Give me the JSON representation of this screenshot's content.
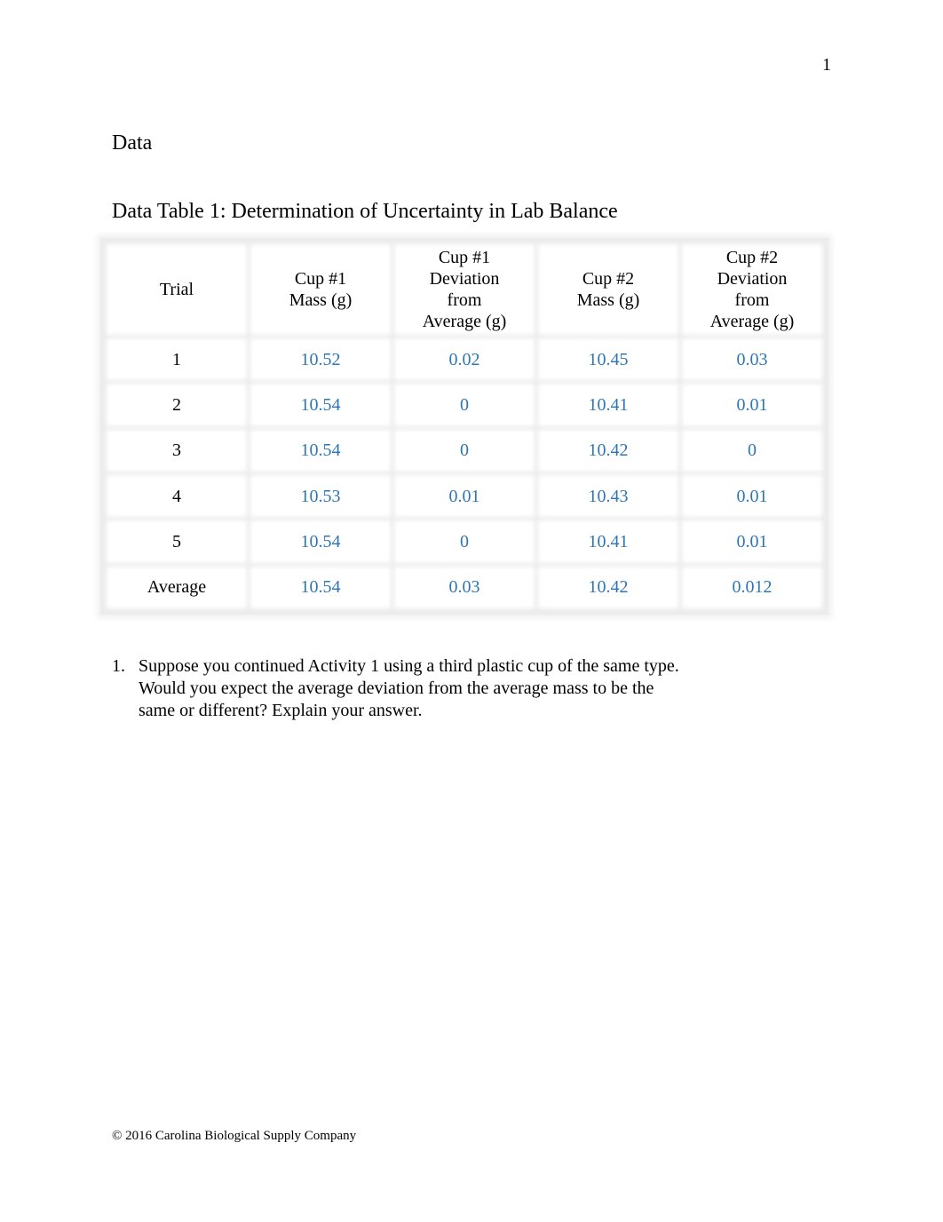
{
  "page_number": "1",
  "section_heading": "Data",
  "table": {
    "title": "Data Table 1: Determination of Uncertainty in Lab Balance",
    "headers": [
      [
        "Trial"
      ],
      [
        "Cup #1",
        "Mass (g)"
      ],
      [
        "Cup #1",
        "Deviation",
        "from",
        "Average (g)"
      ],
      [
        "Cup #2",
        "Mass (g)"
      ],
      [
        "Cup #2",
        "Deviation",
        "from",
        "Average (g)"
      ]
    ],
    "rows": [
      {
        "label": "1",
        "cup1_mass": "10.52",
        "cup1_dev": "0.02",
        "cup2_mass": "10.45",
        "cup2_dev": "0.03"
      },
      {
        "label": "2",
        "cup1_mass": "10.54",
        "cup1_dev": "0",
        "cup2_mass": "10.41",
        "cup2_dev": "0.01"
      },
      {
        "label": "3",
        "cup1_mass": "10.54",
        "cup1_dev": "0",
        "cup2_mass": "10.42",
        "cup2_dev": "0"
      },
      {
        "label": "4",
        "cup1_mass": "10.53",
        "cup1_dev": "0.01",
        "cup2_mass": "10.43",
        "cup2_dev": "0.01"
      },
      {
        "label": "5",
        "cup1_mass": "10.54",
        "cup1_dev": "0",
        "cup2_mass": "10.41",
        "cup2_dev": "0.01"
      },
      {
        "label": "Average",
        "cup1_mass": "10.54",
        "cup1_dev": "0.03",
        "cup2_mass": "10.42",
        "cup2_dev": "0.012"
      }
    ],
    "value_color": "#2e75b6"
  },
  "questions": [
    {
      "number": "1.",
      "text": "Suppose you continued Activity 1 using a third plastic cup of the same type. Would you expect the average deviation from the average mass to be the same or different? Explain your answer."
    }
  ],
  "footer": "© 2016 Carolina Biological Supply Company"
}
